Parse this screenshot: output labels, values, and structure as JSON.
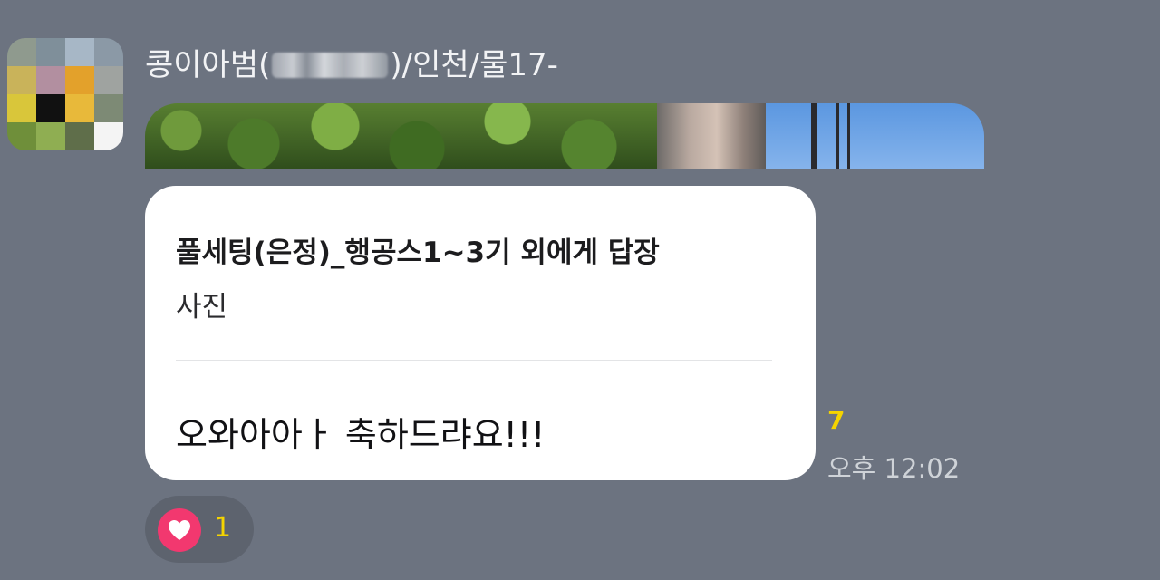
{
  "message": {
    "sender": {
      "name_prefix": "콩이아범(",
      "name_suffix": ")/인천/물17-"
    },
    "photo_attachment": {
      "icon": "photo-thumbnail"
    },
    "reply": {
      "title": "풀세팅(은정)_행공스1~3기 외에게 답장",
      "preview": "사진"
    },
    "text": "오와아아ㅏ 축하드랴요!!!",
    "unread_count": "7",
    "time": "오후 12:02",
    "reactions": [
      {
        "icon": "heart-icon",
        "color": "#f2386f",
        "count": "1"
      }
    ]
  },
  "colors": {
    "background": "#6c7380",
    "bubble": "#ffffff",
    "unread_accent": "#f5d400",
    "reaction_pill": "#5d636e"
  }
}
